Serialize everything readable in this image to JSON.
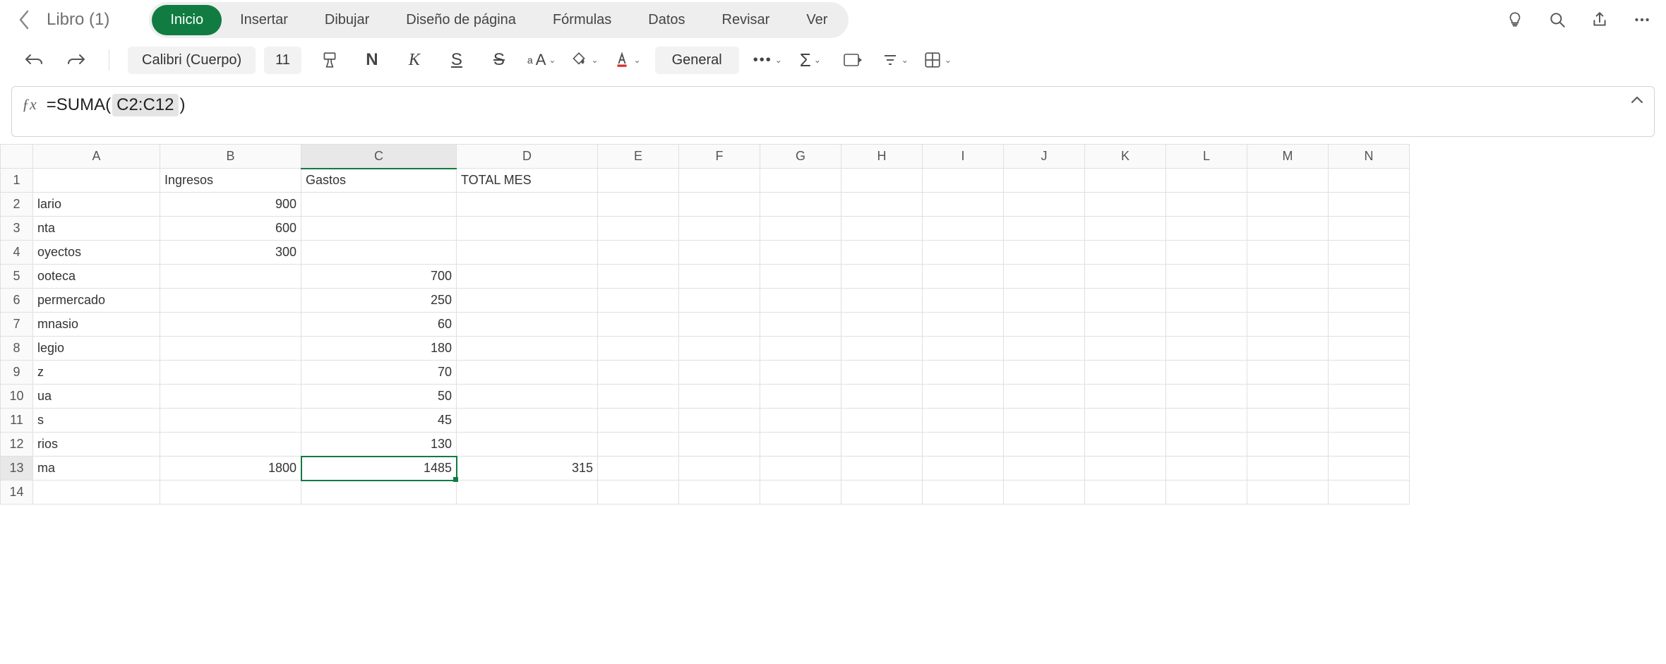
{
  "header": {
    "doc_title": "Libro (1)",
    "tabs": [
      "Inicio",
      "Insertar",
      "Dibujar",
      "Diseño de página",
      "Fórmulas",
      "Datos",
      "Revisar",
      "Ver"
    ],
    "active_tab_index": 0
  },
  "toolbar": {
    "font_name": "Calibri (Cuerpo)",
    "font_size": "11",
    "number_format": "General"
  },
  "formula_bar": {
    "fx_label": "ƒx",
    "prefix": "=SUMA( ",
    "range": "C2:C12",
    "suffix": " )"
  },
  "grid": {
    "columns": [
      "A",
      "B",
      "C",
      "D",
      "E",
      "F",
      "G",
      "H",
      "I",
      "J",
      "K",
      "L",
      "M",
      "N"
    ],
    "selected_col": "C",
    "selected_row": 13,
    "rows": [
      {
        "n": 1,
        "A": "",
        "B": "Ingresos",
        "C": "Gastos",
        "D": "TOTAL MES",
        "bLeft": true,
        "cLeft": true,
        "dLeft": true
      },
      {
        "n": 2,
        "A": "lario",
        "B": "900",
        "C": "",
        "D": ""
      },
      {
        "n": 3,
        "A": "nta",
        "B": "600",
        "C": "",
        "D": ""
      },
      {
        "n": 4,
        "A": "oyectos",
        "B": "300",
        "C": "",
        "D": ""
      },
      {
        "n": 5,
        "A": "ooteca",
        "B": "",
        "C": "700",
        "D": ""
      },
      {
        "n": 6,
        "A": "permercado",
        "B": "",
        "C": "250",
        "D": ""
      },
      {
        "n": 7,
        "A": "mnasio",
        "B": "",
        "C": "60",
        "D": ""
      },
      {
        "n": 8,
        "A": "legio",
        "B": "",
        "C": "180",
        "D": ""
      },
      {
        "n": 9,
        "A": "z",
        "B": "",
        "C": "70",
        "D": ""
      },
      {
        "n": 10,
        "A": "ua",
        "B": "",
        "C": "50",
        "D": ""
      },
      {
        "n": 11,
        "A": "s",
        "B": "",
        "C": "45",
        "D": ""
      },
      {
        "n": 12,
        "A": "rios",
        "B": "",
        "C": "130",
        "D": ""
      },
      {
        "n": 13,
        "A": "ma",
        "B": "1800",
        "C": "1485",
        "D": "315"
      },
      {
        "n": 14,
        "A": "",
        "B": "",
        "C": "",
        "D": ""
      }
    ]
  },
  "chart_data": {
    "type": "table",
    "title": "",
    "columns": [
      "",
      "Ingresos",
      "Gastos",
      "TOTAL MES"
    ],
    "rows": [
      [
        "lario",
        900,
        null,
        null
      ],
      [
        "nta",
        600,
        null,
        null
      ],
      [
        "oyectos",
        300,
        null,
        null
      ],
      [
        "ooteca",
        null,
        700,
        null
      ],
      [
        "permercado",
        null,
        250,
        null
      ],
      [
        "mnasio",
        null,
        60,
        null
      ],
      [
        "legio",
        null,
        180,
        null
      ],
      [
        "z",
        null,
        70,
        null
      ],
      [
        "ua",
        null,
        50,
        null
      ],
      [
        "s",
        null,
        45,
        null
      ],
      [
        "rios",
        null,
        130,
        null
      ],
      [
        "ma",
        1800,
        1485,
        315
      ]
    ]
  }
}
